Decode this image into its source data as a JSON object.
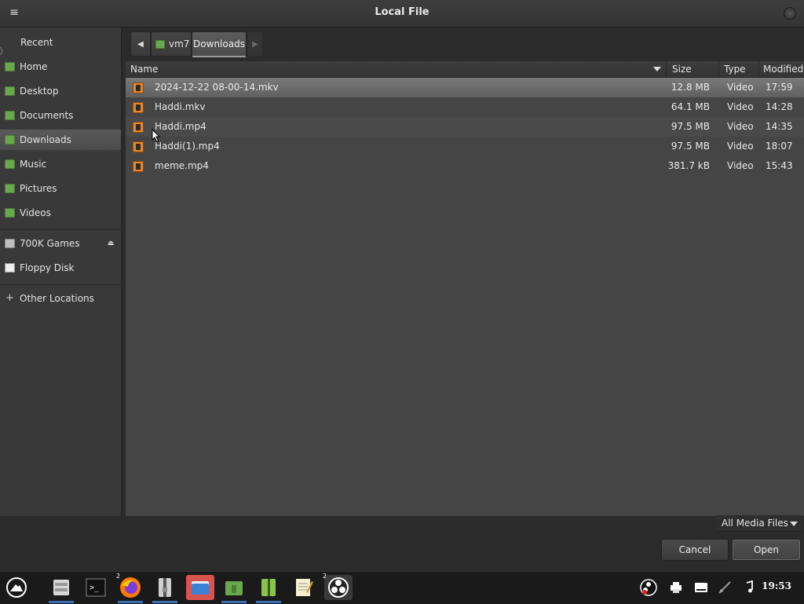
{
  "window": {
    "title": "Local File"
  },
  "sidebar": {
    "places": [
      {
        "label": "Recent",
        "icon": "clock-icon"
      },
      {
        "label": "Home",
        "icon": "home-folder-icon"
      },
      {
        "label": "Desktop",
        "icon": "desktop-folder-icon"
      },
      {
        "label": "Documents",
        "icon": "documents-folder-icon"
      },
      {
        "label": "Downloads",
        "icon": "downloads-folder-icon",
        "active": true
      },
      {
        "label": "Music",
        "icon": "music-folder-icon"
      },
      {
        "label": "Pictures",
        "icon": "pictures-folder-icon"
      },
      {
        "label": "Videos",
        "icon": "videos-folder-icon"
      }
    ],
    "devices": [
      {
        "label": "700K Games",
        "icon": "drive-icon"
      },
      {
        "label": "Floppy Disk",
        "icon": "floppy-icon"
      }
    ],
    "other": {
      "label": "Other Locations",
      "icon": "plus-icon"
    }
  },
  "pathbar": {
    "parent": "vm7",
    "current": "Downloads"
  },
  "columns": {
    "name": "Name",
    "size": "Size",
    "type": "Type",
    "modified": "Modified"
  },
  "files": [
    {
      "name": "2024-12-22 08-00-14.mkv",
      "size": "12.8 MB",
      "type": "Video",
      "modified": "17:59",
      "selected": true
    },
    {
      "name": "Haddi.mkv",
      "size": "64.1 MB",
      "type": "Video",
      "modified": "14:28"
    },
    {
      "name": "Haddi.mp4",
      "size": "97.5 MB",
      "type": "Video",
      "modified": "14:35"
    },
    {
      "name": "Haddi(1).mp4",
      "size": "97.5 MB",
      "type": "Video",
      "modified": "18:07"
    },
    {
      "name": "meme.mp4",
      "size": "381.7 kB",
      "type": "Video",
      "modified": "15:43"
    }
  ],
  "filter": {
    "label": "All Media Files"
  },
  "buttons": {
    "cancel": "Cancel",
    "open": "Open"
  },
  "taskbar": {
    "badges": {
      "firefox": "2",
      "obs": "2"
    },
    "clock": "19:53",
    "accent": "#3b6fb0"
  },
  "colors": {
    "folder_green": "#6aa84f",
    "video_orange": "#e8862a"
  }
}
